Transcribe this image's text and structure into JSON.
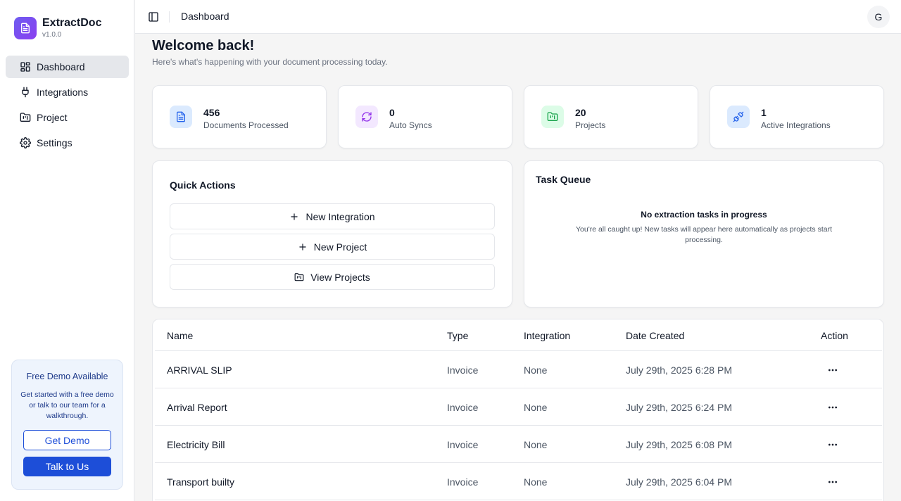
{
  "brand": {
    "name": "ExtractDoc",
    "version": "v1.0.0"
  },
  "sidebar": {
    "items": [
      {
        "label": "Dashboard",
        "icon": "dashboard-icon",
        "active": true
      },
      {
        "label": "Integrations",
        "icon": "plug-icon"
      },
      {
        "label": "Project",
        "icon": "folder-icon"
      },
      {
        "label": "Settings",
        "icon": "gear-icon"
      }
    ],
    "demo": {
      "title": "Free Demo Available",
      "description": "Get started with a free demo or talk to our team for a walkthrough.",
      "primary_label": "Get Demo",
      "secondary_label": "Talk to Us"
    }
  },
  "header": {
    "title": "Dashboard",
    "avatar_initial": "G"
  },
  "welcome": {
    "title": "Welcome back!",
    "subtitle": "Here's what's happening with your document processing today."
  },
  "stats": [
    {
      "value": "456",
      "label": "Documents Processed",
      "icon": "document-icon",
      "color": "#2563eb"
    },
    {
      "value": "0",
      "label": "Auto Syncs",
      "icon": "refresh-icon",
      "color": "#9333ea"
    },
    {
      "value": "20",
      "label": "Projects",
      "icon": "folder-chart-icon",
      "color": "#16a34a"
    },
    {
      "value": "1",
      "label": "Active Integrations",
      "icon": "plug-connect-icon",
      "color": "#2563eb"
    }
  ],
  "quick_actions": {
    "title": "Quick Actions",
    "items": [
      {
        "label": "New Integration",
        "icon": "plus-icon"
      },
      {
        "label": "New Project",
        "icon": "plus-icon"
      },
      {
        "label": "View Projects",
        "icon": "folder-icon"
      }
    ]
  },
  "task_queue": {
    "title": "Task Queue",
    "empty_title": "No extraction tasks in progress",
    "empty_description": "You're all caught up! New tasks will appear here automatically as projects start processing."
  },
  "table": {
    "columns": [
      "Name",
      "Type",
      "Integration",
      "Date Created",
      "Action"
    ],
    "rows": [
      {
        "name": "ARRIVAL SLIP",
        "type": "Invoice",
        "integration": "None",
        "date": "July 29th, 2025 6:28 PM"
      },
      {
        "name": "Arrival Report",
        "type": "Invoice",
        "integration": "None",
        "date": "July 29th, 2025 6:24 PM"
      },
      {
        "name": "Electricity Bill",
        "type": "Invoice",
        "integration": "None",
        "date": "July 29th, 2025 6:08 PM"
      },
      {
        "name": "Transport builty",
        "type": "Invoice",
        "integration": "None",
        "date": "July 29th, 2025 6:04 PM"
      }
    ]
  },
  "colors": {
    "accent": "#1d4ed8",
    "brand_gradient_start": "#6d5cf0",
    "brand_gradient_end": "#8b3ff0"
  }
}
